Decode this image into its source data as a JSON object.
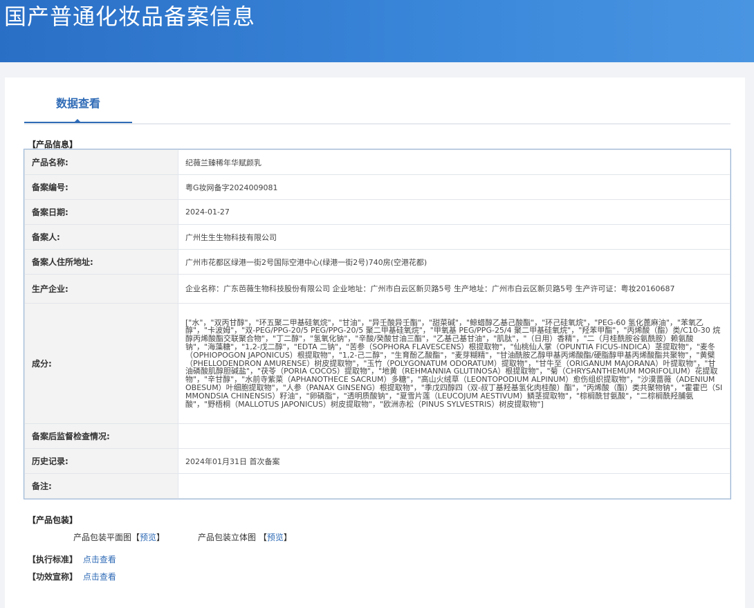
{
  "header": {
    "title": "国产普通化妆品备案信息"
  },
  "tabs": [
    {
      "label": "数据查看"
    }
  ],
  "sections": {
    "product_info": "【产品信息】",
    "packaging": "【产品包装】",
    "standard": "【执行标准】",
    "efficacy": "【功效宣称】"
  },
  "product": {
    "rows": [
      {
        "label": "产品名称:",
        "value": "纪薇兰臻稀年华赋颜乳"
      },
      {
        "label": "备案编号:",
        "value": "粤G妆网备字2024009081"
      },
      {
        "label": "备案日期:",
        "value": "2024-01-27"
      },
      {
        "label": "备案人:",
        "value": "广州生生生物科技有限公司"
      },
      {
        "label": "备案人住所地址:",
        "value": "广州市花都区绿港一街2号国际空港中心(绿港一街2号)740房(空港花都)"
      },
      {
        "label": "生产企业:",
        "value": "企业名称：广东芭薇生物科技股份有限公司 企业地址：广州市白云区新贝路5号 生产地址：广州市白云区新贝路5号 生产许可证：粤妆20160687"
      },
      {
        "label": "成分:",
        "value": "[\"水\"，\"双丙甘醇\"，\"环五聚二甲基硅氧烷\"，\"甘油\"，\"异壬酸异壬酯\"，\"甜菜碱\"，\"鲸蜡醇乙基己酸酯\"，\"环己硅氧烷\"，\"PEG-60 氢化蓖麻油\"，\"苯氧乙醇\"，\"卡波姆\"，\"双-PEG/PPG-20/5 PEG/PPG-20/5 聚二甲基硅氧烷\"，\"甲氧基 PEG/PPG-25/4 聚二甲基硅氧烷\"，\"羟苯甲酯\"，\"丙烯酸（酯）类/C10-30 烷醇丙烯酸酯交联聚合物\"，\"丁二醇\"，\"氢氧化钠\"，\"辛酸/癸酸甘油三酯\"，\"乙基己基甘油\"，\"肌肽\"，\"（日用）香精\"，\"二（月桂酰胺谷氨酰胺）赖氨酸钠\"，\"海藻糖\"，\"1,2-戊二醇\"，\"EDTA 二钠\"，\"苦参（SOPHORA FLAVESCENS）根提取物\"，\"仙桃仙人掌（OPUNTIA FICUS-INDICA）茎提取物\"，\"麦冬（OPHIOPOGON JAPONICUS）根提取物\"，\"1,2-己二醇\"，\"生育酚乙酸酯\"，\"麦芽糊精\"，\"甘油酰胺乙醇甲基丙烯酸酯/硬脂醇甲基丙烯酸酯共聚物\"，\"黄檗（PHELLODENDRON AMURENSE）树皮提取物\"，\"玉竹（POLYGONATUM ODORATUM）提取物\"，\"甘牛至（ORIGANUM MAJORANA）叶提取物\"，\"甘油磷酸肌醇胆碱盐\"，\"茯苓（PORIA COCOS）提取物\"，\"地黄（REHMANNIA GLUTINOSA）根提取物\"，\"菊（CHRYSANTHEMUM MORIFOLIUM）花提取物\"，\"辛甘醇\"，\"水前寺紫菜（APHANOTHECE SACRUM）多糖\"，\"高山火绒草（LEONTOPODIUM ALPINUM）愈伤组织提取物\"，\"沙漠蔷薇（ADENIUM OBESUM）叶细胞提取物\"，\"人参（PANAX GINSENG）根提取物\"，\"季戊四醇四（双-叔丁基羟基氢化肉桂酸）酯\"，\"丙烯酸（酯）类共聚物钠\"，\"霍霍巴（SIMMONDSIA CHINENSIS）籽油\"，\"卵磷脂\"，\"透明质酸钠\"，\"夏雪片莲（LEUCOJUM AESTIVUM）鳞茎提取物\"，\"棕榈酰甘氨酸\"，\"二棕榈酰羟脯氨酸\"，\"野梧桐（MALLOTUS JAPONICUS）树皮提取物\"，\"欧洲赤松（PINUS SYLVESTRIS）树皮提取物\"]"
      },
      {
        "label": "备案后监督检查情况:",
        "value": ""
      },
      {
        "label": "历史记录:",
        "value": "2024年01月31日 首次备案"
      },
      {
        "label": "备注:",
        "value": ""
      }
    ]
  },
  "packaging": {
    "flat_label": "产品包装平面图",
    "flat_preview": "预览",
    "solid_label": "产品包装立体图",
    "solid_preview": "预览"
  },
  "links": {
    "standard": "点击查看",
    "efficacy": "点击查看"
  }
}
